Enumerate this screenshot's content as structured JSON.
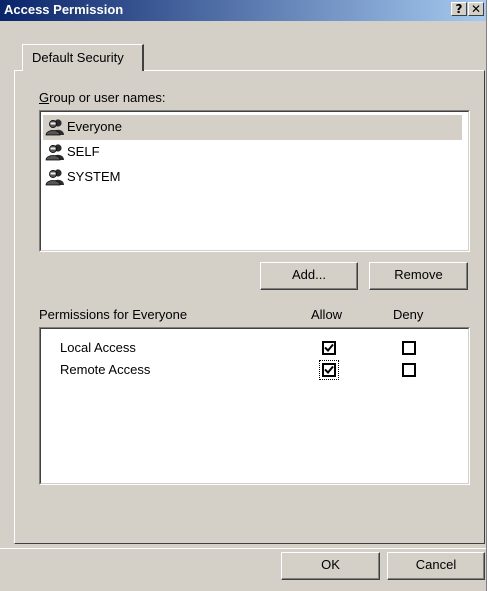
{
  "window": {
    "title": "Access Permission",
    "help_glyph": "?",
    "close_glyph": "✕"
  },
  "tab": {
    "label": "Default Security"
  },
  "group_label": "Group or user names:",
  "users": [
    {
      "name": "Everyone",
      "selected": true
    },
    {
      "name": "SELF",
      "selected": false
    },
    {
      "name": "SYSTEM",
      "selected": false
    }
  ],
  "buttons": {
    "add": "Add...",
    "remove": "Remove",
    "ok": "OK",
    "cancel": "Cancel"
  },
  "permissions": {
    "label": "Permissions for Everyone",
    "allow_header": "Allow",
    "deny_header": "Deny",
    "rows": [
      {
        "name": "Local Access",
        "allow": true,
        "deny": false
      },
      {
        "name": "Remote Access",
        "allow": true,
        "deny": false
      }
    ]
  },
  "colors": {
    "dialog_bg": "#d4d0c8",
    "title_start": "#0a246a",
    "title_end": "#a6caf0"
  },
  "icons": {
    "user": "user-group-icon"
  }
}
